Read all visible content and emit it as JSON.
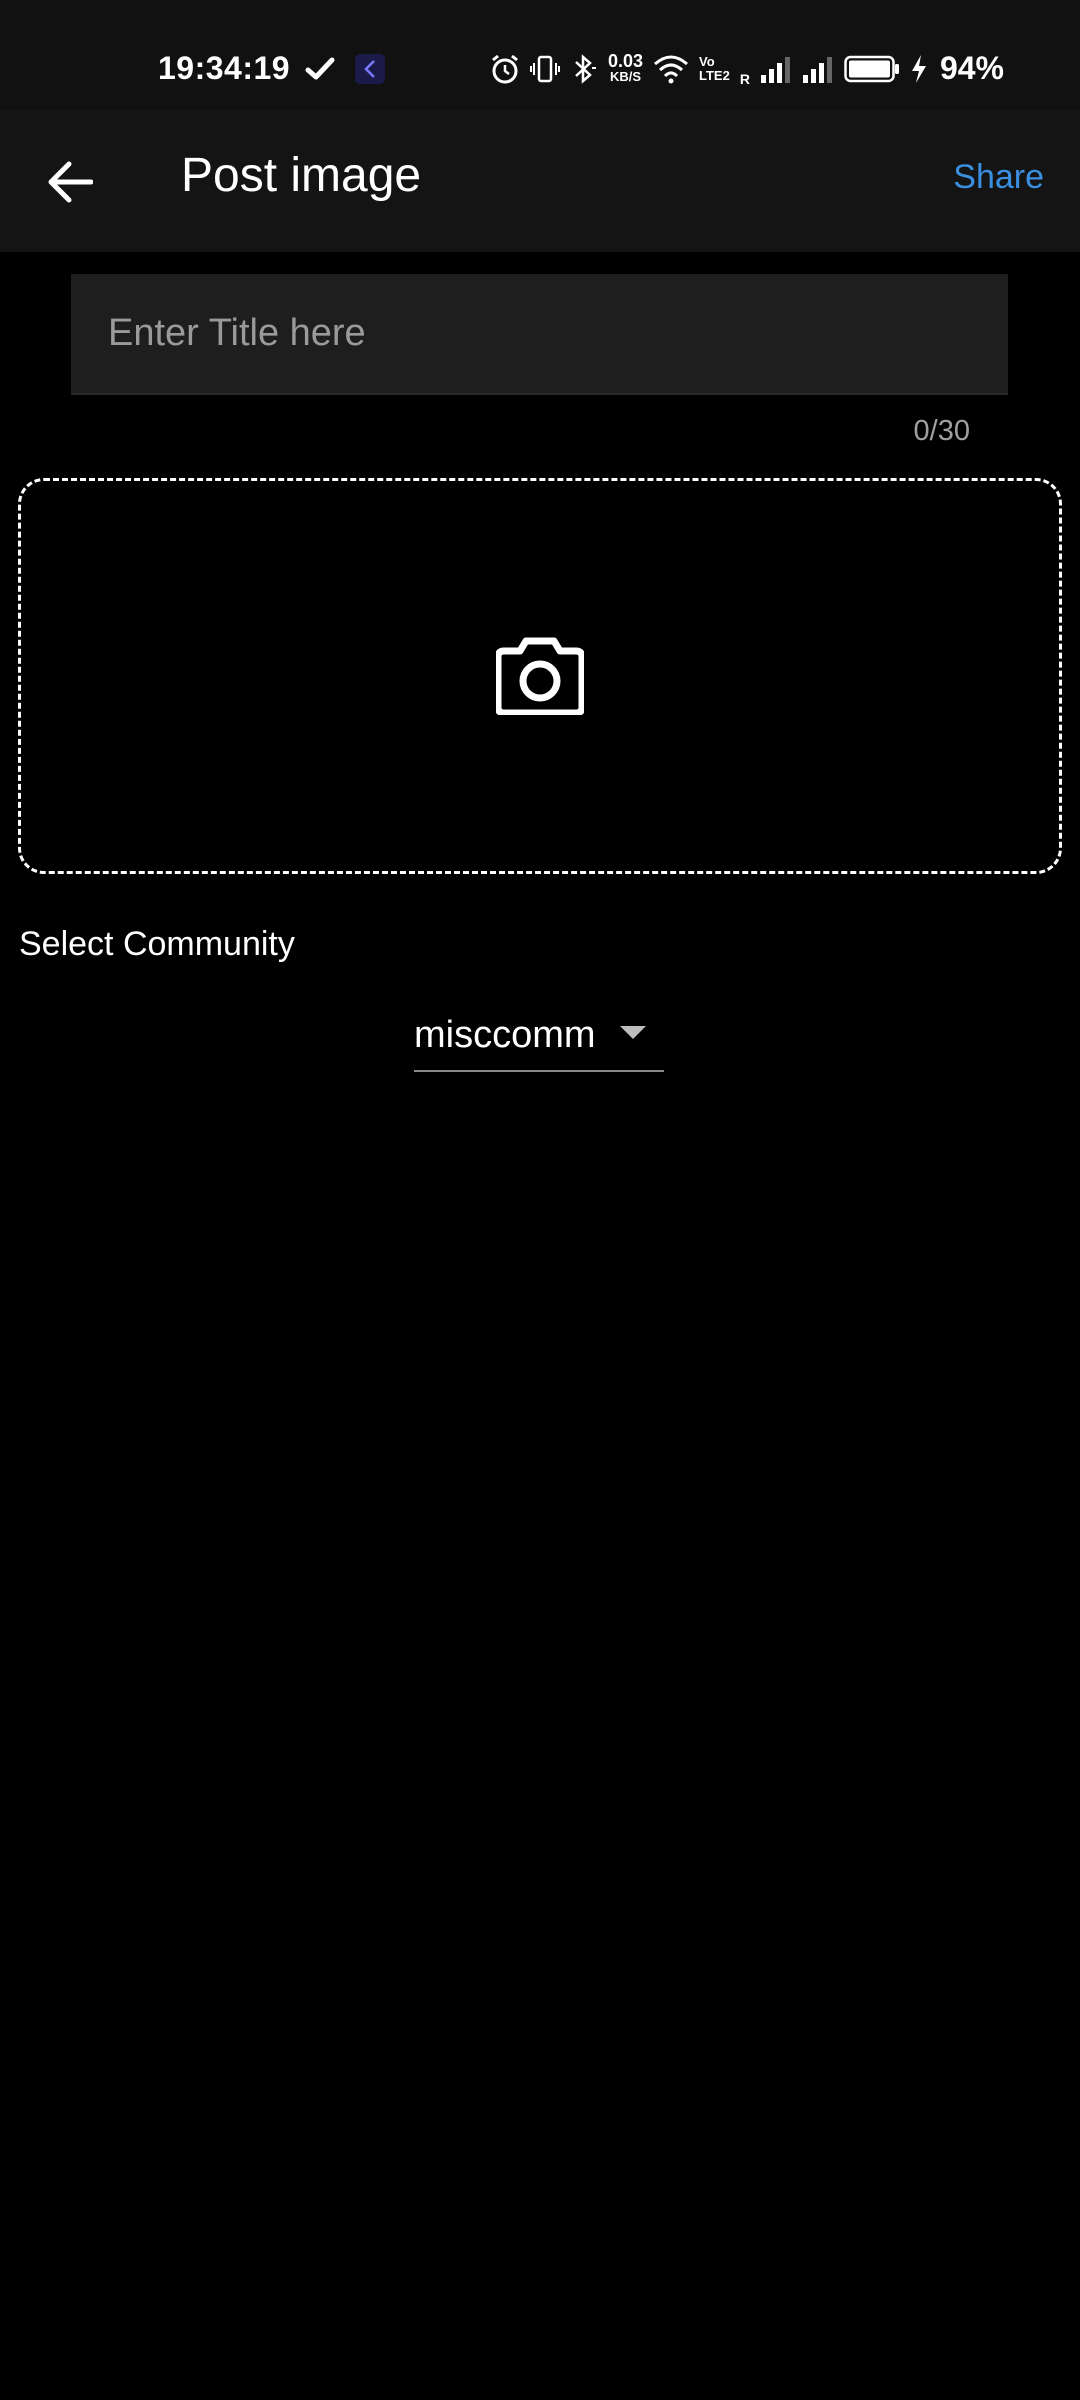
{
  "status_bar": {
    "time": "19:34:19",
    "net_speed_value": "0.03",
    "net_speed_unit": "KB/S",
    "volte_top": "Vo",
    "volte_bottom": "LTE2",
    "roaming": "R",
    "battery_percent": "94%",
    "battery_level": 0.94
  },
  "app_bar": {
    "title": "Post image",
    "share_label": "Share",
    "accent_color": "#3b8fe0"
  },
  "form": {
    "title_placeholder": "Enter Title here",
    "title_value": "",
    "char_count": "0/30",
    "image_picker_icon": "camera-icon",
    "community_label": "Select Community",
    "community_selected": "misccomm"
  }
}
